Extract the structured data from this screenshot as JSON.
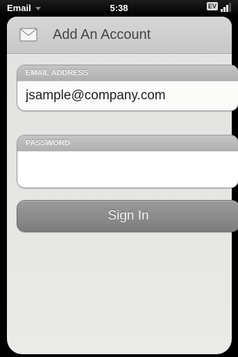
{
  "status_bar": {
    "app_name": "Email",
    "time": "5:38",
    "network_badge": "EV",
    "signal_bars": 3,
    "signal_max": 4
  },
  "header": {
    "icon": "envelope-icon",
    "title": "Add An Account"
  },
  "email": {
    "label": "EMAIL ADDRESS",
    "value": "jsample@company.com"
  },
  "password": {
    "label": "PASSWORD",
    "value": ""
  },
  "actions": {
    "sign_in_label": "Sign In"
  },
  "colors": {
    "button": "#8a8a8a",
    "header": "#cdcdcd",
    "background": "#e4e4e2"
  }
}
